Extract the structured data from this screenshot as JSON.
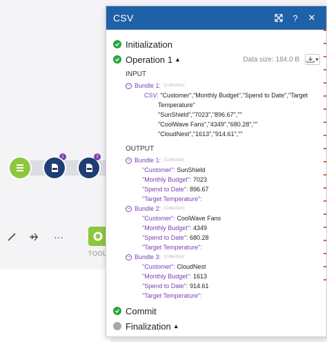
{
  "background": {
    "tools_label": "TOOLS",
    "bubble_1": "1",
    "bubble_2": "2",
    "more_label": "···"
  },
  "dialog": {
    "title": "CSV",
    "header_icons": [
      "expand-icon",
      "help-icon",
      "close-icon"
    ],
    "help_label": "?",
    "close_label": "✕",
    "phases": {
      "initialization": "Initialization",
      "operation": "Operation 1",
      "commit": "Commit",
      "finalization": "Finalization"
    },
    "data_size": "Data size: 184.0 B",
    "input_label": "INPUT",
    "output_label": "OUTPUT",
    "collection_label": "(Collection)",
    "input_bundle": {
      "name": "Bundle 1:",
      "csv_key": "CSV:",
      "csv_lines": [
        "\"Customer\",\"Monthly Budget\",\"Spend to Date\",\"Target",
        "Temperature\"",
        "\"SunShield\",\"7023\",\"896.67\",\"\"",
        "\"CoolWave Fans\",\"4349\",\"680.28\",\"\"",
        "\"CloudNest\",\"1613\",\"914.61\",\"\""
      ]
    },
    "output_bundles": [
      {
        "name": "Bundle 1:",
        "fields": [
          {
            "key": "\"Customer\":",
            "value": "SunShield"
          },
          {
            "key": "\"Monthly Budget\":",
            "value": "7023"
          },
          {
            "key": "\"Spend to Date\":",
            "value": "896.67"
          },
          {
            "key": "\"Target Temperature\":",
            "value": ""
          }
        ]
      },
      {
        "name": "Bundle 2:",
        "fields": [
          {
            "key": "\"Customer\":",
            "value": "CoolWave Fans"
          },
          {
            "key": "\"Monthly Budget\":",
            "value": "4349"
          },
          {
            "key": "\"Spend to Date\":",
            "value": "680.28"
          },
          {
            "key": "\"Target Temperature\":",
            "value": ""
          }
        ]
      },
      {
        "name": "Bundle 3:",
        "fields": [
          {
            "key": "\"Customer\":",
            "value": "CloudNest"
          },
          {
            "key": "\"Monthly Budget\":",
            "value": "1613"
          },
          {
            "key": "\"Spend to Date\":",
            "value": "914.61"
          },
          {
            "key": "\"Target Temperature\":",
            "value": ""
          }
        ]
      }
    ]
  },
  "colors": {
    "header_blue": "#1f61a8",
    "success_green": "#27a63f",
    "bundle_purple": "#7b3fb5",
    "module_green": "#8dc63f",
    "module_navy": "#1f3e72"
  }
}
